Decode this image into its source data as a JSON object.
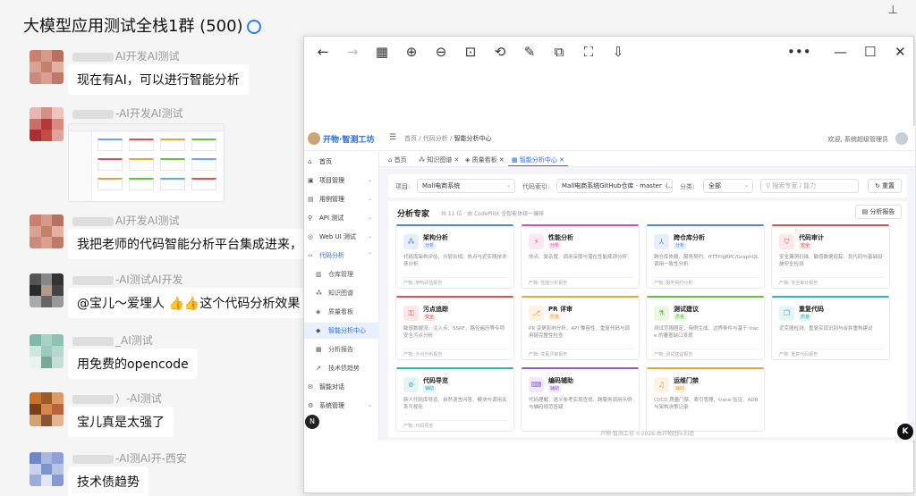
{
  "chat": {
    "title": "大模型应用测试全栈1群 (500)",
    "messages": [
      {
        "sender": "AI开发AI测试",
        "text": "现在有AI，可以进行智能分析",
        "colors": [
          "#c9826f",
          "#d49b8a",
          "#b7725f",
          "#d9a293",
          "#c48068",
          "#e0b2a2",
          "#c98c7c",
          "#d9a090",
          "#bd7a68"
        ]
      },
      {
        "sender": "-AI开发AI测试",
        "text": "",
        "colors": [
          "#e7b8b0",
          "#d18f87",
          "#f0c4bd",
          "#c86f68",
          "#b33a3a",
          "#d88a80",
          "#a93030",
          "#c44b46",
          "#dba59c"
        ]
      },
      {
        "sender": "AI开发AI测试",
        "text": "我把老师的代码智能分析平台集成进来，",
        "colors": [
          "#c9826f",
          "#d49b8a",
          "#b7725f",
          "#d9a293",
          "#c48068",
          "#e0b2a2",
          "#c98c7c",
          "#d9a090",
          "#bd7a68"
        ]
      },
      {
        "sender": "-AI测试AI开发",
        "text": "@宝儿～爱埋人 👍👍这个代码分析效果",
        "colors": [
          "#555",
          "#888",
          "#333",
          "#2b2b2b",
          "#b29a8a",
          "#444",
          "#aaa",
          "#666",
          "#999"
        ]
      },
      {
        "sender": "_AI测试",
        "text": "用免费的opencode",
        "colors": [
          "#7fb7a8",
          "#a9d2c6",
          "#8fc1b3",
          "#cfe6df",
          "#9ccbbd",
          "#b6d9ce",
          "#e8f2ef",
          "#7aa897",
          "#c4e0d6"
        ]
      },
      {
        "sender": "）-AI测试",
        "text": "宝儿真是太强了",
        "colors": [
          "#c9702b",
          "#9a5a2a",
          "#e09a62",
          "#7a3e1a",
          "#d8874a",
          "#b9623b",
          "#d7a070",
          "#8a5532",
          "#e3b490"
        ]
      },
      {
        "sender": "-AI测AI开-西安",
        "text": "技术债趋势",
        "colors": [
          "#6f86c9",
          "#a7b7e0",
          "#8ea1d6",
          "#c9d3ee",
          "#7b93cf",
          "#b5c3e6",
          "#9aaddb",
          "#dfe6f5",
          "#8798d2"
        ]
      }
    ]
  },
  "browser": {
    "toolbar_icons": [
      "back-icon",
      "forward-icon",
      "apps-grid-icon",
      "zoom-in-icon",
      "zoom-out-icon",
      "fit-page-icon",
      "rotate-icon",
      "edit-icon",
      "copy-icon",
      "screenshot-icon",
      "download-icon"
    ],
    "more_label": "•••",
    "min_label": "—",
    "max_label": "☐",
    "close_label": "✕"
  },
  "app": {
    "name": "开物·智测工坊",
    "breadcrumb": [
      "首页",
      "代码分析",
      "智能分析中心"
    ],
    "welcome": "欢迎, 系统超级管理员",
    "sidebar": [
      {
        "label": "首页",
        "icon": "⌂",
        "arrow": "",
        "type": "top"
      },
      {
        "label": "项目管理",
        "icon": "▣",
        "arrow": "⌄",
        "type": "top"
      },
      {
        "label": "用例管理",
        "icon": "▤",
        "arrow": "⌄",
        "type": "top"
      },
      {
        "label": "API 测试",
        "icon": "⚲",
        "arrow": "⌄",
        "type": "top"
      },
      {
        "label": "Web UI 测试",
        "icon": "◎",
        "arrow": "⌄",
        "type": "top"
      },
      {
        "label": "代码分析",
        "icon": "‹›",
        "arrow": "⌃",
        "type": "open"
      },
      {
        "label": "仓库管理",
        "icon": "▥",
        "arrow": "",
        "type": "sub"
      },
      {
        "label": "知识图谱",
        "icon": "⁂",
        "arrow": "",
        "type": "sub"
      },
      {
        "label": "质量看板",
        "icon": "◈",
        "arrow": "",
        "type": "sub"
      },
      {
        "label": "智能分析中心",
        "icon": "◆",
        "arrow": "",
        "type": "active"
      },
      {
        "label": "分析报告",
        "icon": "▦",
        "arrow": "",
        "type": "sub"
      },
      {
        "label": "技术债趋势",
        "icon": "↗",
        "arrow": "",
        "type": "sub"
      },
      {
        "label": "智能对话",
        "icon": "✉",
        "arrow": "",
        "type": "top"
      },
      {
        "label": "系统管理",
        "icon": "⚙",
        "arrow": "⌄",
        "type": "top"
      }
    ],
    "tabs": [
      {
        "label": "⌂ 首页"
      },
      {
        "label": "⁂ 知识图谱 ✕"
      },
      {
        "label": "◈ 质量看板 ✕"
      },
      {
        "label": "▦ 智能分析中心 ✕"
      }
    ],
    "filter": {
      "project_label": "项目:",
      "project_value": "Mall电商系统",
      "index_label": "代码索引:",
      "index_value": "Mall电商系统GitHub仓库 · master（...",
      "category_label": "分类:",
      "category_value": "全部",
      "search_placeholder": "搜索专家 / 能力",
      "reset_label": "↻ 重置"
    },
    "panel": {
      "title": "分析专家",
      "subtitle": "共 11 位 · 由 CodePilot 全智能体统一编排",
      "report_label": "▤ 分析报告"
    },
    "cards": [
      {
        "title": "架构分析",
        "badge": "分析",
        "desc": "代码库架构评估、分层合规、热点与近实随技术债分析",
        "prod": "产物: 架构评估报告",
        "color": "#4a86f0",
        "icon": "⁂"
      },
      {
        "title": "性能分析",
        "badge": "分析",
        "desc": "热点、复杂度、调用深度与潜在性能瓶颈分析",
        "prod": "产物: 性能分析报告",
        "color": "#e04db0",
        "icon": "⚡"
      },
      {
        "title": "跨仓库分析",
        "badge": "分析",
        "desc": "跨仓库依赖、服务契约、HTTP/gRPC/GraphQL 调用一致性分析",
        "prod": "产物: 服务契约分析",
        "color": "#4a86f0",
        "icon": "⅄"
      },
      {
        "title": "代码审计",
        "badge": "安全",
        "desc": "安全漏洞扫描、敏感数据追踪、死代码与基础设施安全检测",
        "prod": "产物: 安全审计报告",
        "color": "#e05050",
        "icon": "⛉"
      },
      {
        "title": "污点追踪",
        "badge": "安全",
        "desc": "敏感数据流、注入点、SSRF、路径遍历等专项安全污点分析",
        "prod": "产物: 污点分析报告",
        "color": "#e05050",
        "icon": "⚿"
      },
      {
        "title": "PR 评审",
        "badge": "质量",
        "desc": "PR 变更影响分析、API 兼容性、重复代码与调用链完整性检查",
        "prod": "产物: 变更评审报告",
        "color": "#e6a23c",
        "icon": "⎇"
      },
      {
        "title": "测试建议",
        "badge": "质量",
        "desc": "测试范围圈定、用例生成、边界条件与基于 trace 的覆盖缺口发现",
        "prod": "产物: 测试建议报告",
        "color": "#67c23a",
        "icon": "⚗"
      },
      {
        "title": "重复代码",
        "badge": "质量",
        "desc": "近克隆检测、重复实现识别与合并重构建议",
        "prod": "产物: 重复代码报告",
        "color": "#36b5b0",
        "icon": "❐"
      },
      {
        "title": "代码导览",
        "badge": "辅助",
        "desc": "新人代码库导览、自然语言问答、模块与调用关系可视化",
        "prod": "产物: 代码导览",
        "color": "#36b5b0",
        "icon": "⊘"
      },
      {
        "title": "编码辅助",
        "badge": "辅助",
        "desc": "代码理解、语义参考实现查找、跨服务调用示例与编码规范答疑",
        "prod": "",
        "color": "#8e5bd6",
        "icon": "⌨"
      },
      {
        "title": "运维门禁",
        "badge": "辅助",
        "desc": "CI/CD 质量门禁、索引管理、trace 验证、ADR 与架构决策记录",
        "prod": "",
        "color": "#e6a23c",
        "icon": "♫"
      }
    ],
    "footer": "开物·智测工坊 ©2026 由开物团队创造",
    "bottom_left": "N",
    "bottom_right": "K"
  }
}
